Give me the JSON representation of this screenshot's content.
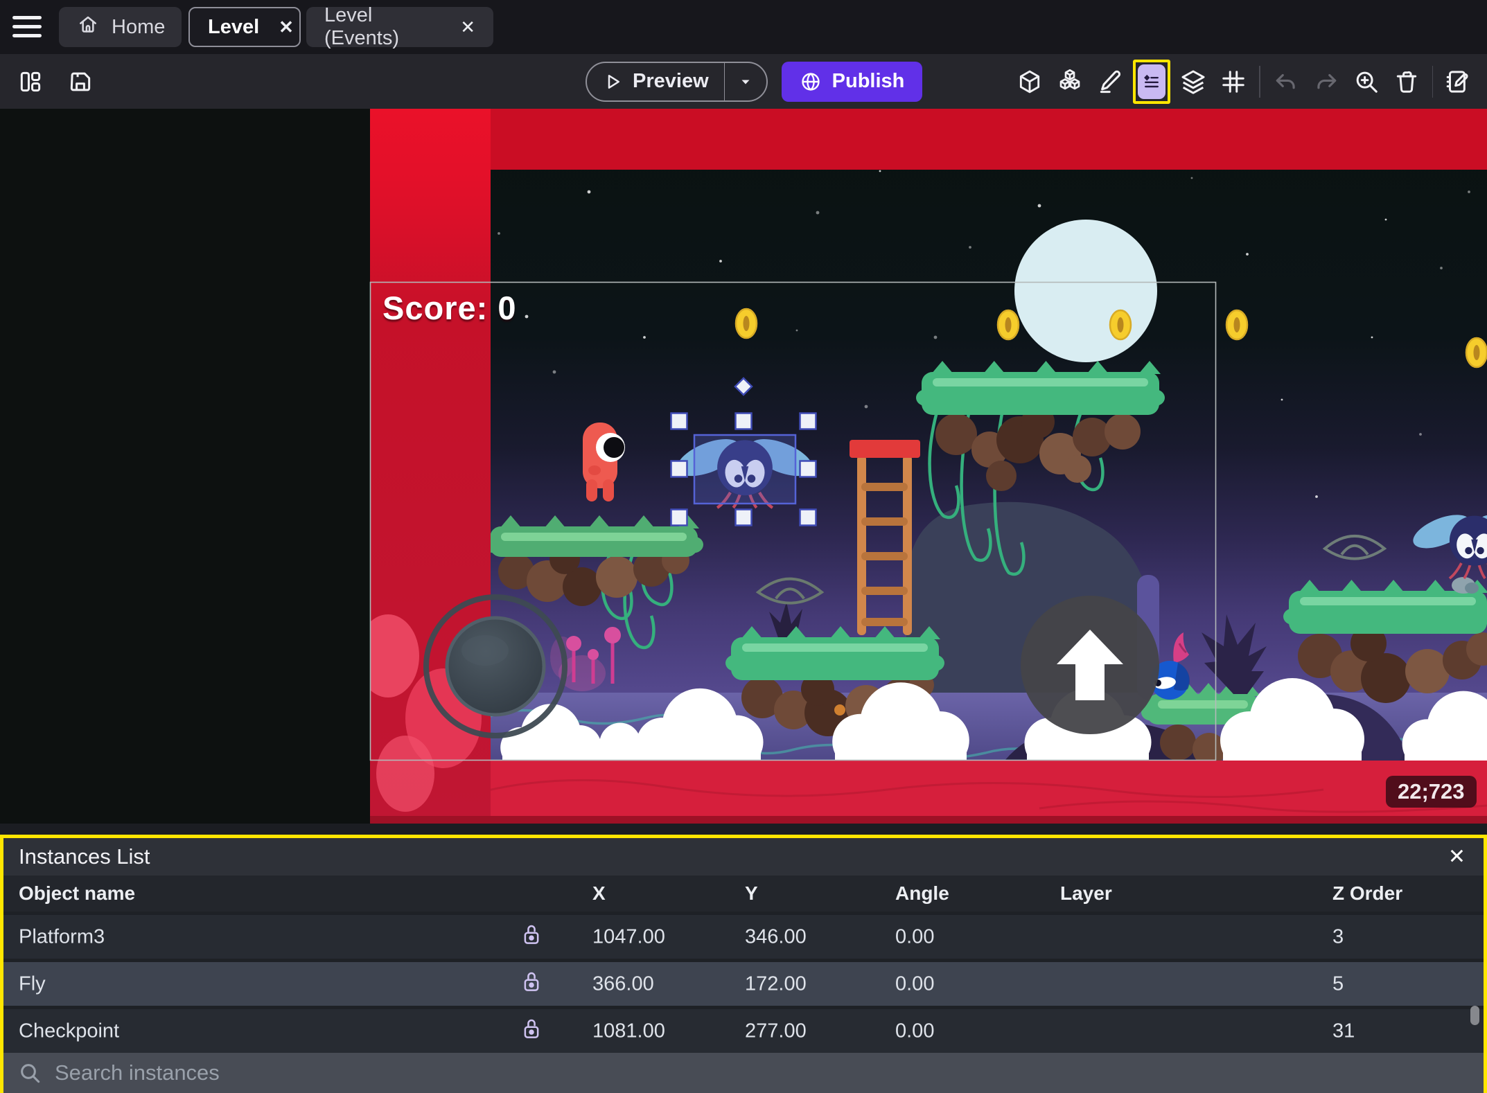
{
  "tabs": {
    "home_label": "Home",
    "level_label": "Level",
    "level_events_label": "Level (Events)"
  },
  "icons": {
    "close": "✕"
  },
  "toolbar": {
    "preview_label": "Preview",
    "publish_label": "Publish"
  },
  "scene": {
    "score_text": "Score: 0",
    "coords_badge": "22;723"
  },
  "instances_panel": {
    "title": "Instances List",
    "columns": [
      "Object name",
      "X",
      "Y",
      "Angle",
      "Layer",
      "Z Order"
    ],
    "rows": [
      {
        "name": "Platform3",
        "x": "1047.00",
        "y": "346.00",
        "angle": "0.00",
        "layer": "",
        "z": "3"
      },
      {
        "name": "Fly",
        "x": "366.00",
        "y": "172.00",
        "angle": "0.00",
        "layer": "",
        "z": "5"
      },
      {
        "name": "Checkpoint",
        "x": "1081.00",
        "y": "277.00",
        "angle": "0.00",
        "layer": "",
        "z": "31"
      }
    ],
    "search_placeholder": "Search instances"
  },
  "colors": {
    "accent_purple": "#6130e8",
    "highlight_yellow": "#ffe600",
    "selection_blue": "#5563d6",
    "scene_red": "#e81029"
  }
}
